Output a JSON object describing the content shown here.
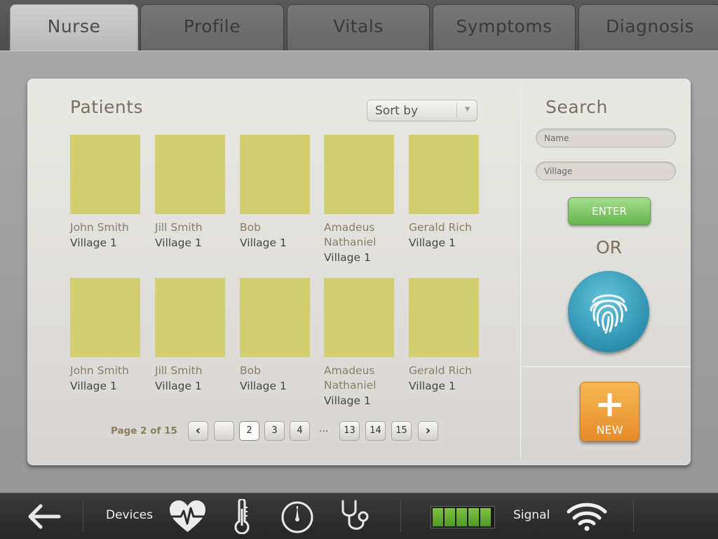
{
  "tabs": [
    {
      "label": "Nurse",
      "active": true
    },
    {
      "label": "Profile",
      "active": false
    },
    {
      "label": "Vitals",
      "active": false
    },
    {
      "label": "Symptoms",
      "active": false
    },
    {
      "label": "Diagnosis",
      "active": false
    }
  ],
  "patients": {
    "title": "Patients",
    "sort_label": "Sort by",
    "list": [
      {
        "name": "John Smith",
        "village": "Village 1"
      },
      {
        "name": "Jill Smith",
        "village": "Village 1"
      },
      {
        "name": "Bob",
        "village": "Village 1"
      },
      {
        "name": "Amadeus Nathaniel",
        "village": "Village 1"
      },
      {
        "name": "Gerald Rich",
        "village": "Village 1"
      },
      {
        "name": "John Smith",
        "village": "Village 1"
      },
      {
        "name": "Jill Smith",
        "village": "Village 1"
      },
      {
        "name": "Bob",
        "village": "Village 1"
      },
      {
        "name": "Amadeus Nathaniel",
        "village": "Village 1"
      },
      {
        "name": "Gerald Rich",
        "village": "Village 1"
      }
    ]
  },
  "pagination": {
    "label": "Page 2 of 15",
    "prev": "‹",
    "next": "›",
    "pages": [
      "",
      "2",
      "3",
      "4",
      "13",
      "14",
      "15"
    ],
    "ellipsis": "...",
    "current": "2"
  },
  "search": {
    "title": "Search",
    "name_placeholder": "Name",
    "village_placeholder": "Village",
    "enter_label": "ENTER",
    "or_label": "OR",
    "fingerprint_icon": "fingerprint-icon",
    "new_label": "NEW",
    "new_icon": "+"
  },
  "bottom_bar": {
    "back_icon": "back-arrow-icon",
    "devices_label": "Devices",
    "device_icons": [
      "heart-rate-icon",
      "thermometer-icon",
      "gauge-icon",
      "stethoscope-icon"
    ],
    "battery_cells": 5,
    "signal_label": "Signal",
    "signal_icon": "wifi-icon"
  },
  "colors": {
    "thumb": "#d2d072",
    "enter": "#64b54b",
    "fingerprint": "#2c8fad",
    "new": "#e78b2b",
    "title": "#7d6f5b"
  }
}
